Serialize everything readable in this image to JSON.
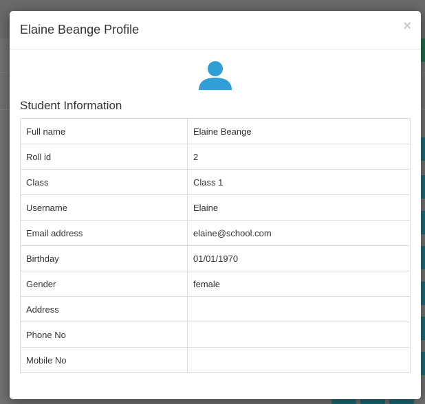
{
  "modal": {
    "title": "Elaine Beange Profile",
    "close_symbol": "×",
    "avatar_icon": "user-icon",
    "section_title": "Student Information",
    "rows": [
      {
        "label": "Full name",
        "value": "Elaine Beange"
      },
      {
        "label": "Roll id",
        "value": "2"
      },
      {
        "label": "Class",
        "value": "Class 1"
      },
      {
        "label": "Username",
        "value": "Elaine"
      },
      {
        "label": "Email address",
        "value": "elaine@school.com"
      },
      {
        "label": "Birthday",
        "value": "01/01/1970"
      },
      {
        "label": "Gender",
        "value": "female"
      },
      {
        "label": "Address",
        "value": ""
      },
      {
        "label": "Phone No",
        "value": ""
      },
      {
        "label": "Mobile No",
        "value": ""
      }
    ]
  },
  "colors": {
    "accent_icon": "#2f9fd6",
    "overlay": "#727272",
    "teal_buttons": "#1a6b77",
    "green_button": "#1e6b4d"
  }
}
